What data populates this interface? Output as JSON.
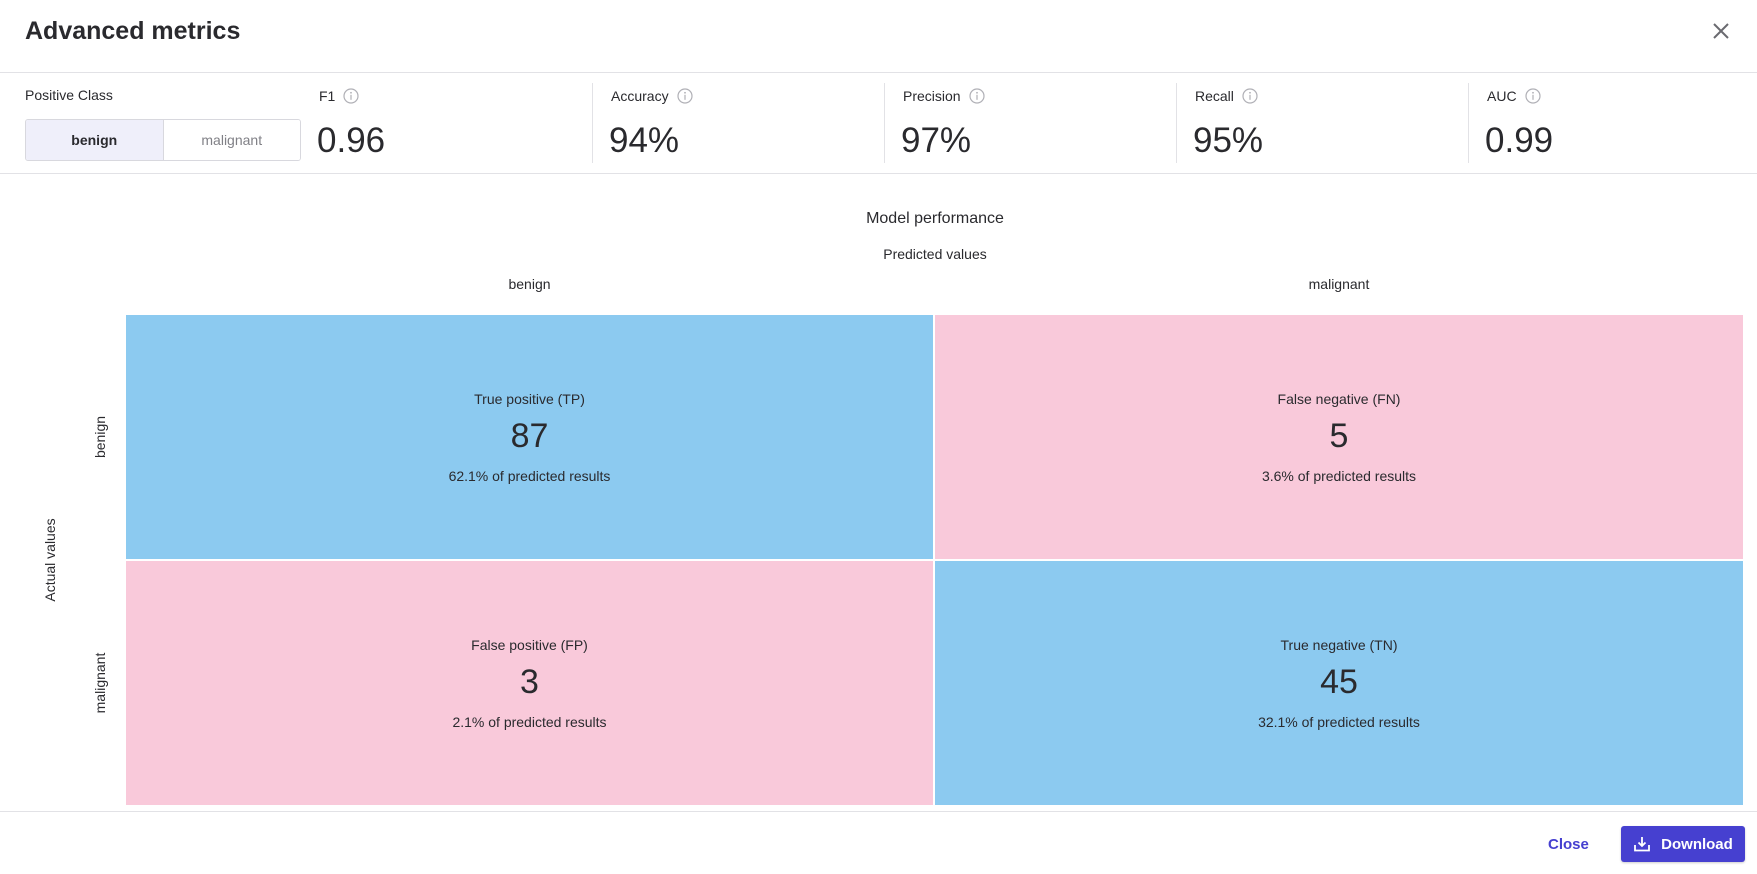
{
  "dialog": {
    "title": "Advanced metrics",
    "close_icon": "close-icon"
  },
  "positive_class": {
    "label": "Positive Class",
    "options": [
      "benign",
      "malignant"
    ],
    "selected": "benign"
  },
  "metrics": [
    {
      "label": "F1",
      "value": "0.96",
      "icon": "info-icon"
    },
    {
      "label": "Accuracy",
      "value": "94%",
      "icon": "info-icon"
    },
    {
      "label": "Precision",
      "value": "97%",
      "icon": "info-icon"
    },
    {
      "label": "Recall",
      "value": "95%",
      "icon": "info-icon"
    },
    {
      "label": "AUC",
      "value": "0.99",
      "icon": "info-icon"
    }
  ],
  "chart_data": {
    "type": "heatmap",
    "title": "Model performance",
    "xlabel": "Predicted values",
    "ylabel": "Actual values",
    "x_categories": [
      "benign",
      "malignant"
    ],
    "y_categories": [
      "benign",
      "malignant"
    ],
    "cells": [
      {
        "row": 0,
        "col": 0,
        "name": "True positive (TP)",
        "count": "87",
        "pct": "62.1% of predicted results",
        "kind": "correct"
      },
      {
        "row": 0,
        "col": 1,
        "name": "False negative (FN)",
        "count": "5",
        "pct": "3.6% of predicted results",
        "kind": "error"
      },
      {
        "row": 1,
        "col": 0,
        "name": "False positive (FP)",
        "count": "3",
        "pct": "2.1% of predicted results",
        "kind": "error"
      },
      {
        "row": 1,
        "col": 1,
        "name": "True negative (TN)",
        "count": "45",
        "pct": "32.1% of predicted results",
        "kind": "correct"
      }
    ],
    "colors": {
      "correct": "#8ccaf0",
      "error": "#f9c9da"
    }
  },
  "footer": {
    "close_label": "Close",
    "download_label": "Download",
    "download_icon": "download-icon",
    "accent": "#4640d0"
  }
}
